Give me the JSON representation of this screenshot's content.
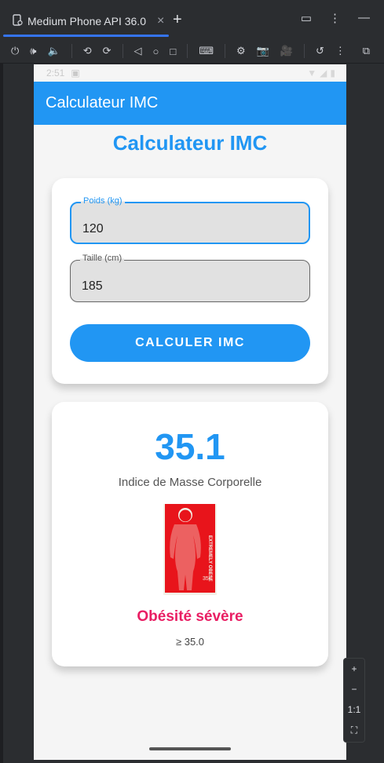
{
  "ide": {
    "tab_title": "Medium Phone API 36.0",
    "tab_close": "×",
    "new_tab": "+",
    "window_icons": [
      "window-icon",
      "more-icon",
      "minimize-icon"
    ],
    "zoom_reset": "1:1",
    "zoom_in": "+",
    "zoom_out": "−"
  },
  "phone": {
    "status_time": "2:51",
    "appbar_title": "Calculateur IMC",
    "page_title": "Calculateur IMC",
    "form": {
      "weight_label": "Poids (kg)",
      "weight_value": "120",
      "height_label": "Taille (cm)",
      "height_value": "185",
      "button_label": "CALCULER IMC"
    },
    "result": {
      "bmi_value": "35.1",
      "bmi_caption": "Indice de Masse Corporelle",
      "category": "Obésité sévère",
      "range": "≥ 35.0",
      "image_text_side": "EXTREMELY OBESE",
      "image_text_corner": "35<"
    }
  },
  "colors": {
    "primary": "#2196f3",
    "category": "#e91e63",
    "ide_bg": "#2b2d30"
  }
}
